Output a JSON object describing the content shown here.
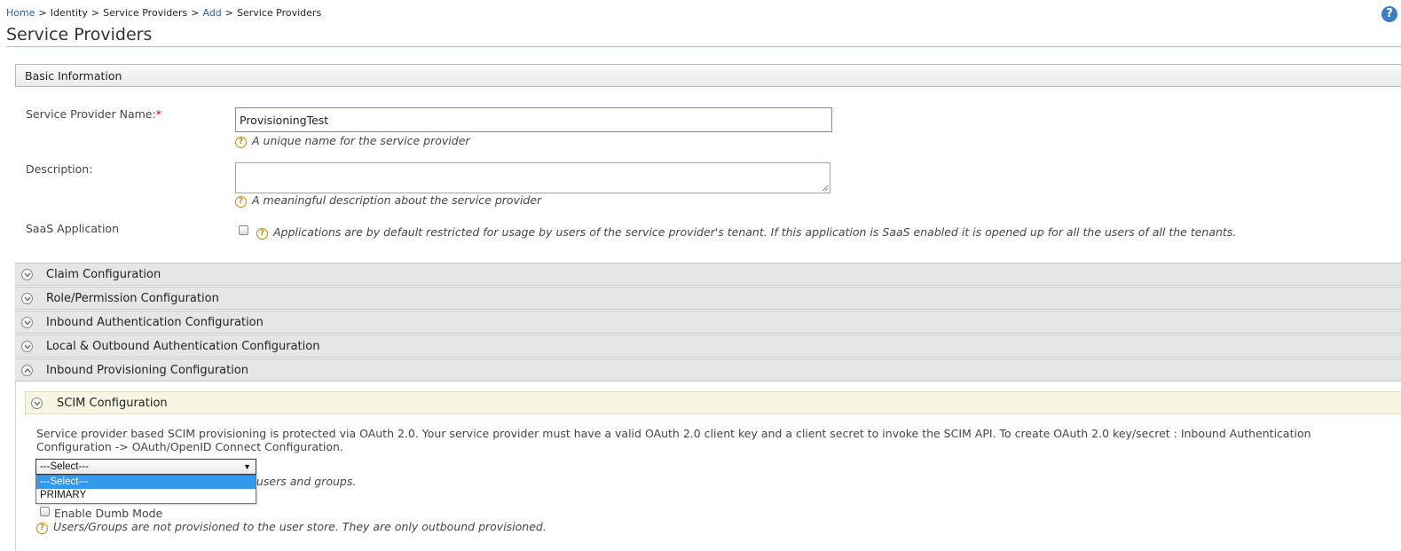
{
  "breadcrumb": {
    "home": "Home",
    "identity": "Identity",
    "service_providers": "Service Providers",
    "add": "Add",
    "current": "Service Providers",
    "separator": ">"
  },
  "help_icon": {
    "glyph": "?",
    "icon": "help-icon"
  },
  "page_title": "Service Providers",
  "basic_info": {
    "header": "Basic Information",
    "name_label": "Service Provider Name:",
    "required_mark": "*",
    "name_value": "ProvisioningTest",
    "name_hint": "A unique name for the service provider",
    "description_label": "Description:",
    "description_value": "",
    "description_hint": "A meaningful description about the service provider",
    "saas_label": "SaaS Application",
    "saas_checked": false,
    "saas_hint": "Applications are by default restricted for usage by users of the service provider's tenant. If this application is SaaS enabled it is opened up for all the users of all the tenants."
  },
  "accordions": [
    {
      "label": "Claim Configuration",
      "expanded": false
    },
    {
      "label": "Role/Permission Configuration",
      "expanded": false
    },
    {
      "label": "Inbound Authentication Configuration",
      "expanded": false
    },
    {
      "label": "Local & Outbound Authentication Configuration",
      "expanded": false
    },
    {
      "label": "Inbound Provisioning Configuration",
      "expanded": true
    }
  ],
  "scim": {
    "header": "SCIM Configuration",
    "description": "Service provider based SCIM provisioning is protected via OAuth 2.0. Your service provider must have a valid OAuth 2.0 client key and a client secret to invoke the SCIM API. To create OAuth 2.0 key/secret : Inbound Authentication Configuration -> OAuth/OpenID Connect Configuration.",
    "select_value": "---Select---",
    "select_arrow": "▼",
    "options": [
      "---Select---",
      "PRIMARY"
    ],
    "partial_hint": "ision users and groups.",
    "dumb_mode_label": "Enable Dumb Mode",
    "dumb_mode_checked": false,
    "dumb_mode_hint": "Users/Groups are not provisioned to the user store. They are only outbound provisioned."
  },
  "colors": {
    "link": "#2a5db0",
    "required": "#dd0000",
    "hint_icon": "#c38b00",
    "selected_option": "#3399ee"
  }
}
